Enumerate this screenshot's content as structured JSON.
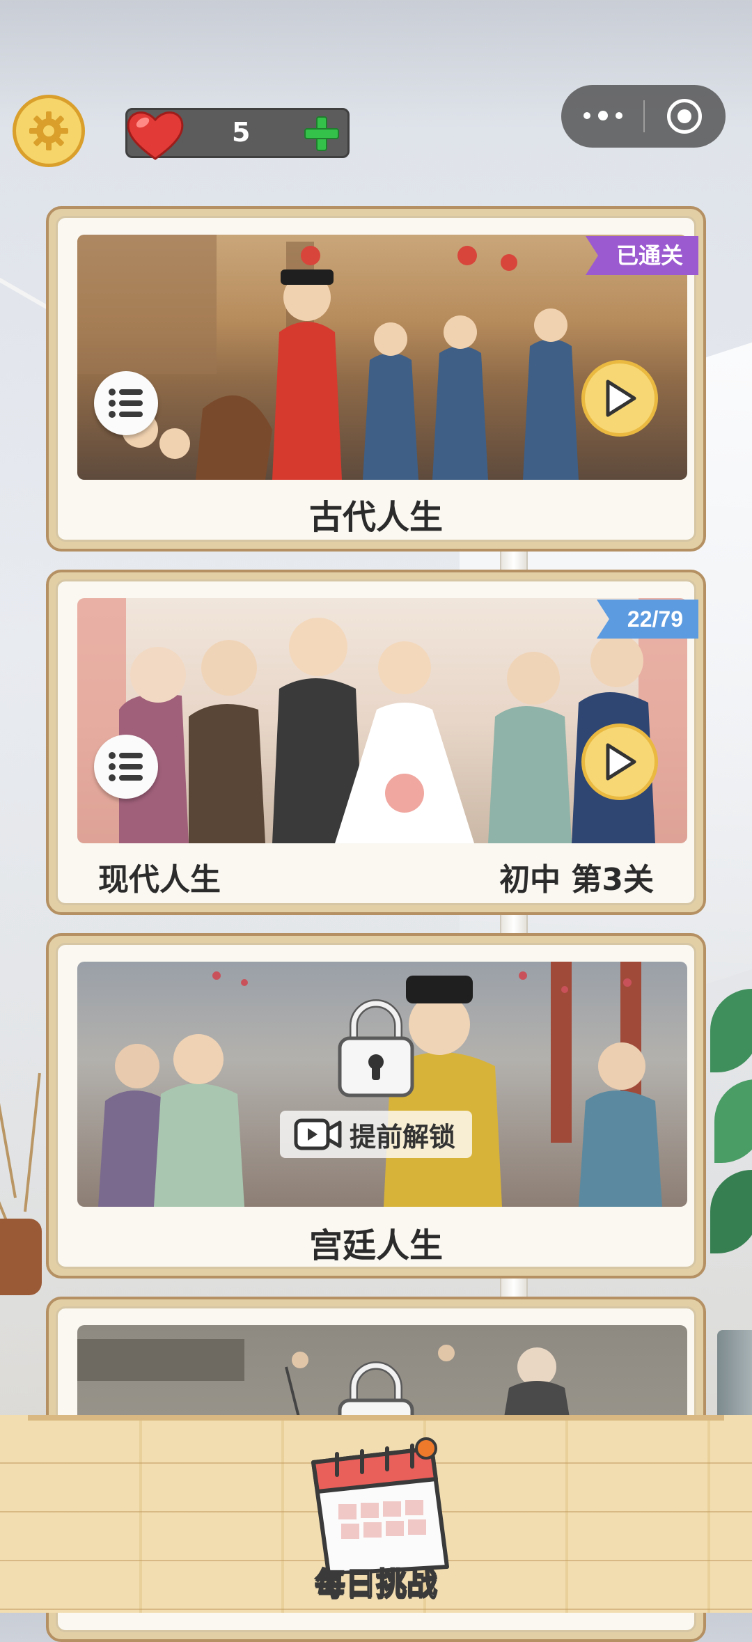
{
  "top_bar": {
    "lives_count": "5",
    "icons": {
      "settings": "gear-icon",
      "lives": "heart-icon",
      "add": "plus-icon",
      "more": "more-dots-icon",
      "close": "target-icon"
    }
  },
  "cards": [
    {
      "title": "古代人生",
      "badge": "已通关",
      "badge_color": "#9b5ad0",
      "state": "completed"
    },
    {
      "title": "现代人生",
      "progress_text": "初中 第3关",
      "badge": "22/79",
      "badge_color": "#5d9be0",
      "state": "in-progress"
    },
    {
      "title": "宫廷人生",
      "unlock_label": "提前解锁",
      "state": "locked"
    },
    {
      "title": "",
      "state": "locked"
    }
  ],
  "daily": {
    "label": "每日挑战"
  },
  "colors": {
    "accent_yellow": "#f7d774",
    "card_border": "#b49062",
    "card_bg": "#faf8f1"
  }
}
